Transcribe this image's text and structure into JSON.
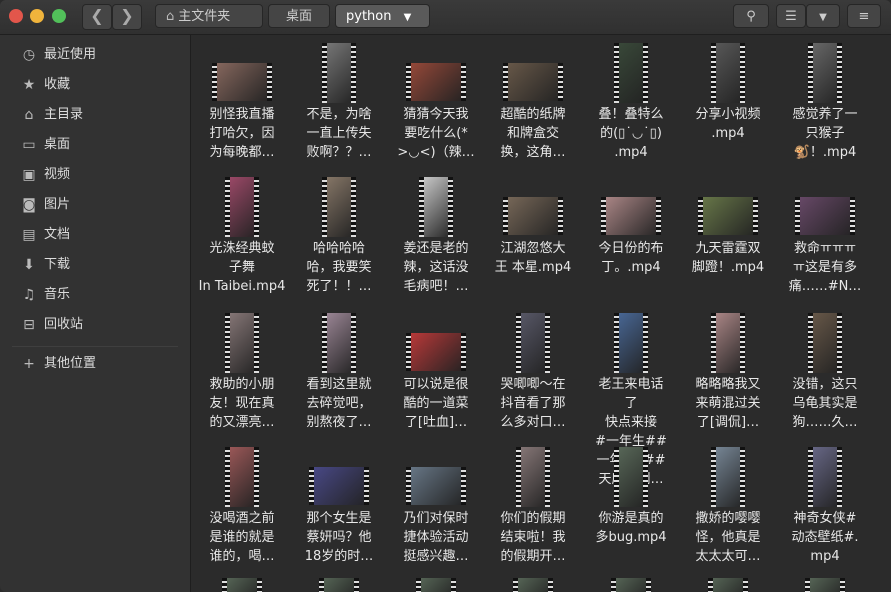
{
  "breadcrumbs": [
    "主文件夹",
    "桌面",
    "python"
  ],
  "sidebar": {
    "items": [
      {
        "icon": "clock-icon",
        "glyph": "◷",
        "label": "最近使用"
      },
      {
        "icon": "star-icon",
        "glyph": "★",
        "label": "收藏"
      },
      {
        "icon": "home-icon",
        "glyph": "⌂",
        "label": "主目录"
      },
      {
        "icon": "desktop-icon",
        "glyph": "▭",
        "label": "桌面"
      },
      {
        "icon": "video-icon",
        "glyph": "▣",
        "label": "视频"
      },
      {
        "icon": "camera-icon",
        "glyph": "◙",
        "label": "图片"
      },
      {
        "icon": "document-icon",
        "glyph": "▤",
        "label": "文档"
      },
      {
        "icon": "download-icon",
        "glyph": "⬇",
        "label": "下载"
      },
      {
        "icon": "music-icon",
        "glyph": "♫",
        "label": "音乐"
      },
      {
        "icon": "trash-icon",
        "glyph": "⊟",
        "label": "回收站"
      }
    ],
    "other": {
      "icon": "plus-icon",
      "glyph": "+",
      "label": "其他位置"
    }
  },
  "files": [
    {
      "lines": [
        "别怪我直播",
        "打哈欠，因",
        "为每晚都…"
      ],
      "thumb_color": "#8a6a60",
      "shape": "wide"
    },
    {
      "lines": [
        "不是，为啥",
        "一直上传失",
        "败啊？？…"
      ],
      "thumb_color": "#7a7a7a",
      "shape": "tall"
    },
    {
      "lines": [
        "猜猜今天我",
        "要吃什么(*",
        ">◡<)（辣…"
      ],
      "thumb_color": "#9a4a3a",
      "shape": "wide"
    },
    {
      "lines": [
        "超酷的纸牌",
        "和牌盒交",
        "换，这角…"
      ],
      "thumb_color": "#6a5a4a",
      "shape": "wide"
    },
    {
      "lines": [
        "叠！叠特么",
        "的(▯˙◡˙▯)",
        ".mp4"
      ],
      "thumb_color": "#3a4a3a",
      "shape": "tall"
    },
    {
      "lines": [
        "分享小视频",
        ".mp4"
      ],
      "thumb_color": "#5a5a5a",
      "shape": "tall"
    },
    {
      "lines": [
        "感觉养了一",
        "只猴子",
        "🐒！.mp4"
      ],
      "thumb_color": "#6a6a6a",
      "shape": "tall"
    },
    {
      "lines": [
        "光洙经典蚊",
        "子舞",
        "In Taibei.mp4"
      ],
      "thumb_color": "#a04a6a",
      "shape": "tall"
    },
    {
      "lines": [
        "哈哈哈哈",
        "哈，我要笑",
        "死了！！…"
      ],
      "thumb_color": "#8a7a6a",
      "shape": "tall"
    },
    {
      "lines": [
        "姜还是老的",
        "辣，这话没",
        "毛病吧！…"
      ],
      "thumb_color": "#d0d0d0",
      "shape": "tall"
    },
    {
      "lines": [
        "江湖忽悠大",
        "王 本星.mp4"
      ],
      "thumb_color": "#7a6a5a",
      "shape": "wide"
    },
    {
      "lines": [
        "今日份的布",
        "丁。.mp4"
      ],
      "thumb_color": "#b08a8a",
      "shape": "wide"
    },
    {
      "lines": [
        "九天雷霆双",
        "脚蹬！.mp4"
      ],
      "thumb_color": "#6a7a4a",
      "shape": "wide"
    },
    {
      "lines": [
        "救命ㅠㅠㅠ",
        "ㅠ这是有多",
        "痛……#N…"
      ],
      "thumb_color": "#6a4a6a",
      "shape": "wide"
    },
    {
      "lines": [
        "救助的小朋",
        "友！现在真",
        "的又漂亮…"
      ],
      "thumb_color": "#8a7a7a",
      "shape": "tall"
    },
    {
      "lines": [
        "看到这里就",
        "去碎觉吧，",
        "别熬夜了…"
      ],
      "thumb_color": "#a08a9a",
      "shape": "tall"
    },
    {
      "lines": [
        "可以说是很",
        "酷的一道菜",
        "了[吐血]…"
      ],
      "thumb_color": "#c03a3a",
      "shape": "wide"
    },
    {
      "lines": [
        "哭唧唧～在",
        "抖音看了那",
        "么多对口…"
      ],
      "thumb_color": "#5a5a6a",
      "shape": "tall"
    },
    {
      "lines": [
        "老王来电话",
        "了",
        "快点来接",
        "#一年生##",
        "一年生5##",
        "天府泰剧…"
      ],
      "thumb_color": "#4a6a9a",
      "shape": "tall"
    },
    {
      "lines": [
        "略略略我又",
        "来萌混过关",
        "了[调侃]…"
      ],
      "thumb_color": "#b08a8a",
      "shape": "tall"
    },
    {
      "lines": [
        "没错，这只",
        "乌龟其实是",
        "狗……久…"
      ],
      "thumb_color": "#6a5a4a",
      "shape": "tall"
    },
    {
      "lines": [
        "没喝酒之前",
        "是谁的就是",
        "谁的，喝…"
      ],
      "thumb_color": "#a05a5a",
      "shape": "tall"
    },
    {
      "lines": [
        "那个女生是",
        "蔡妍吗？他",
        "18岁的时…"
      ],
      "thumb_color": "#4a4a8a",
      "shape": "wide"
    },
    {
      "lines": [
        "乃们对保时",
        "捷体验活动",
        "挺感兴趣…"
      ],
      "thumb_color": "#6a7a8a",
      "shape": "wide"
    },
    {
      "lines": [
        "你们的假期",
        "结束啦！我",
        "的假期开…"
      ],
      "thumb_color": "#8a7a7a",
      "shape": "tall"
    },
    {
      "lines": [
        "你游是真的",
        "多bug.mp4"
      ],
      "thumb_color": "#5a6a5a",
      "shape": "tall"
    },
    {
      "lines": [
        "撒娇的嘤嘤",
        "怪，他真是",
        "太太太可…"
      ],
      "thumb_color": "#7a8a9a",
      "shape": "tall"
    },
    {
      "lines": [
        "神奇女侠#",
        "动态壁纸#.",
        "mp4"
      ],
      "thumb_color": "#6a6a8a",
      "shape": "tall"
    }
  ]
}
